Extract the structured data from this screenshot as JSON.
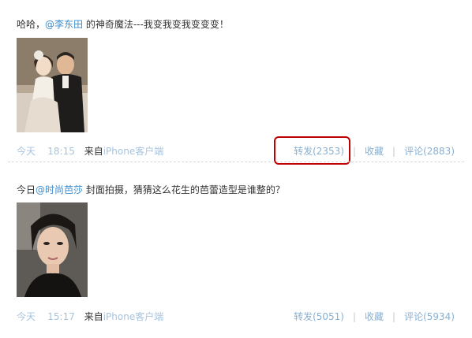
{
  "posts": [
    {
      "text_before": "哈哈，",
      "mention": "@李东田",
      "text_after": " 的神奇魔法---我变我变我变变变！",
      "time": "今天",
      "clock": "18:15",
      "from_label": "来自",
      "client": "iPhone客户端",
      "repost": "转发(2353)",
      "favorite": "收藏",
      "comment": "评论(2883)",
      "repost_highlighted": true
    },
    {
      "text_before": "今日",
      "mention": "@时尚芭莎",
      "text_after": " 封面拍摄，猜猜这么花生的芭蕾造型是谁整的？",
      "time": "今天",
      "clock": "15:17",
      "from_label": "来自",
      "client": "iPhone客户端",
      "repost": "转发(5051)",
      "favorite": "收藏",
      "comment": "评论(5934)",
      "repost_highlighted": false
    }
  ],
  "colors": {
    "link": "#3b8bcc",
    "meta_link": "#8ab0d0",
    "highlight": "#c00000"
  }
}
